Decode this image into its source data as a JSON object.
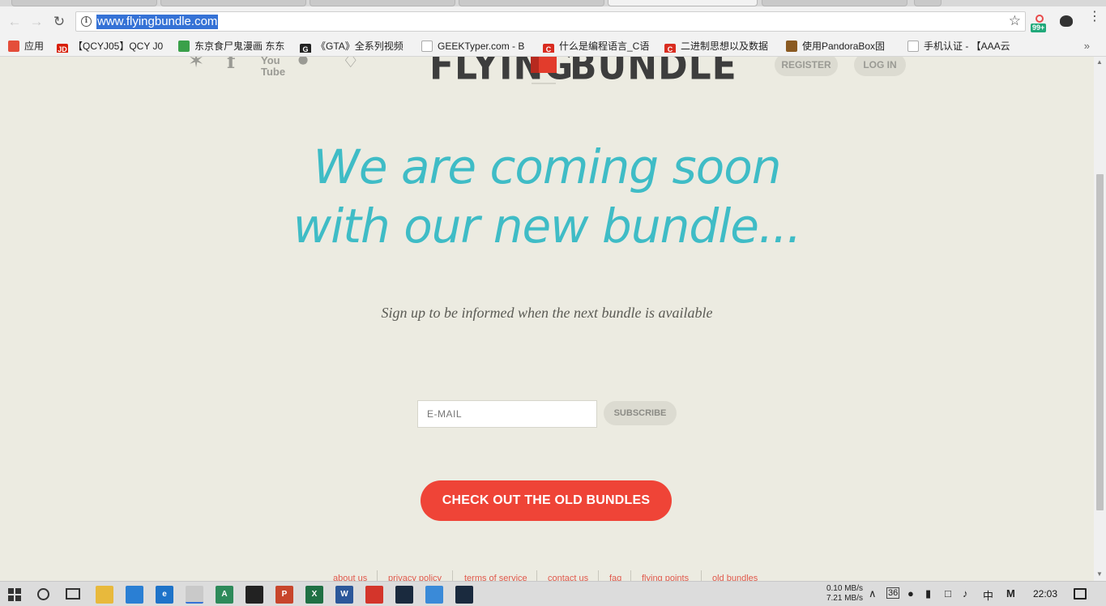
{
  "browser": {
    "url": "www.flyingbundle.com",
    "extension_badge": "99+",
    "bookmarks": [
      {
        "label": "应用",
        "color": "#e44d3a"
      },
      {
        "label": "【QCYJ05】QCY J0",
        "color": "#d81e06"
      },
      {
        "label": "东京食尸鬼漫画 东东",
        "color": "#3aa04a"
      },
      {
        "label": "《GTA》全系列视频",
        "color": "#222222"
      },
      {
        "label": "GEEKTyper.com - B",
        "color": "#bbbbbb"
      },
      {
        "label": "什么是编程语言_C语",
        "color": "#d92c20"
      },
      {
        "label": "二进制思想以及数据",
        "color": "#d92c20"
      },
      {
        "label": "使用PandoraBox固",
        "color": "#8a5a22"
      },
      {
        "label": "手机认证 - 【AAA云",
        "color": "#bbbbbb"
      }
    ]
  },
  "header": {
    "logo_left": "FLYING",
    "logo_right": "BUNDLE",
    "register_label": "REGISTER",
    "login_label": "LOG IN",
    "social_icons": [
      "twitter-icon",
      "facebook-icon",
      "youtube-icon",
      "steam-icon",
      "humble-icon"
    ]
  },
  "main": {
    "headline_line1": "We are coming soon",
    "headline_line2": "with our new bundle...",
    "subtext": "Sign up to be informed when the next bundle is available",
    "email_placeholder": "E-MAIL",
    "subscribe_label": "SUBSCRIBE",
    "cta_label": "CHECK OUT THE OLD BUNDLES"
  },
  "footer": {
    "links": [
      "about us",
      "privacy policy",
      "terms of service",
      "contact us",
      "faq",
      "flying points",
      "old bundles"
    ]
  },
  "taskbar": {
    "upload_speed": "0.10 MB/s",
    "download_speed": "7.21 MB/s",
    "tray_badge": "36",
    "ime": "中",
    "time": "22:03"
  },
  "colors": {
    "page_bg": "#ecebe1",
    "headline": "#3fbcc6",
    "cta": "#ef4437",
    "logo_red": "#e23c2c"
  }
}
